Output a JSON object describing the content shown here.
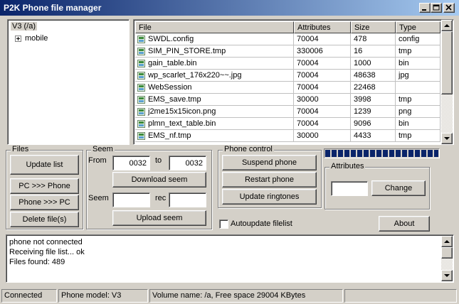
{
  "window": {
    "title": "P2K Phone file manager"
  },
  "tree": {
    "root": "V3 (/a)",
    "children": [
      "mobile"
    ]
  },
  "files": {
    "columns": [
      "File",
      "Attributes",
      "Size",
      "Type"
    ],
    "rows": [
      [
        "SWDL.config",
        "70004",
        "478",
        "config"
      ],
      [
        "SIM_PIN_STORE.tmp",
        "330006",
        "16",
        "tmp"
      ],
      [
        "gain_table.bin",
        "70004",
        "1000",
        "bin"
      ],
      [
        "wp_scarlet_176x220~~.jpg",
        "70004",
        "48638",
        "jpg"
      ],
      [
        "WebSession",
        "70004",
        "22468",
        ""
      ],
      [
        "EMS_save.tmp",
        "30000",
        "3998",
        "tmp"
      ],
      [
        "j2me15x15icon.png",
        "70004",
        "1239",
        "png"
      ],
      [
        "plmn_text_table.bin",
        "70004",
        "9096",
        "bin"
      ],
      [
        "EMS_nf.tmp",
        "30000",
        "4433",
        "tmp"
      ]
    ]
  },
  "files_group": {
    "title": "Files",
    "update_list": "Update list",
    "pc_to_phone": "PC >>> Phone",
    "phone_to_pc": "Phone >>> PC",
    "delete": "Delete file(s)"
  },
  "seem_group": {
    "title": "Seem",
    "from_label": "From",
    "from_value": "0032",
    "to_label": "to",
    "to_value": "0032",
    "download": "Download seem",
    "seem_label": "Seem",
    "seem_value": "",
    "rec_label": "rec",
    "rec_value": "",
    "upload": "Upload seem"
  },
  "phone_group": {
    "title": "Phone control",
    "suspend": "Suspend phone",
    "restart": "Restart phone",
    "ringtones": "Update ringtones"
  },
  "progress": {
    "value": 1.0
  },
  "attributes_group": {
    "title": "Attributes",
    "value": "",
    "change": "Change"
  },
  "autoupdate": {
    "label": "Autoupdate filelist",
    "checked": false
  },
  "about": "About",
  "log": [
    "phone not connected",
    "Receiving file list... ok",
    "Files found: 489"
  ],
  "statusbar": {
    "connection": "Connected",
    "model": "Phone model: V3",
    "volume": "Volume name: /a, Free space 29004 KBytes",
    "extra": ""
  },
  "colors": {
    "titlebar_start": "#0a246a",
    "titlebar_end": "#a6caf0",
    "face": "#d4d0c8",
    "progress": "#0a246a"
  }
}
